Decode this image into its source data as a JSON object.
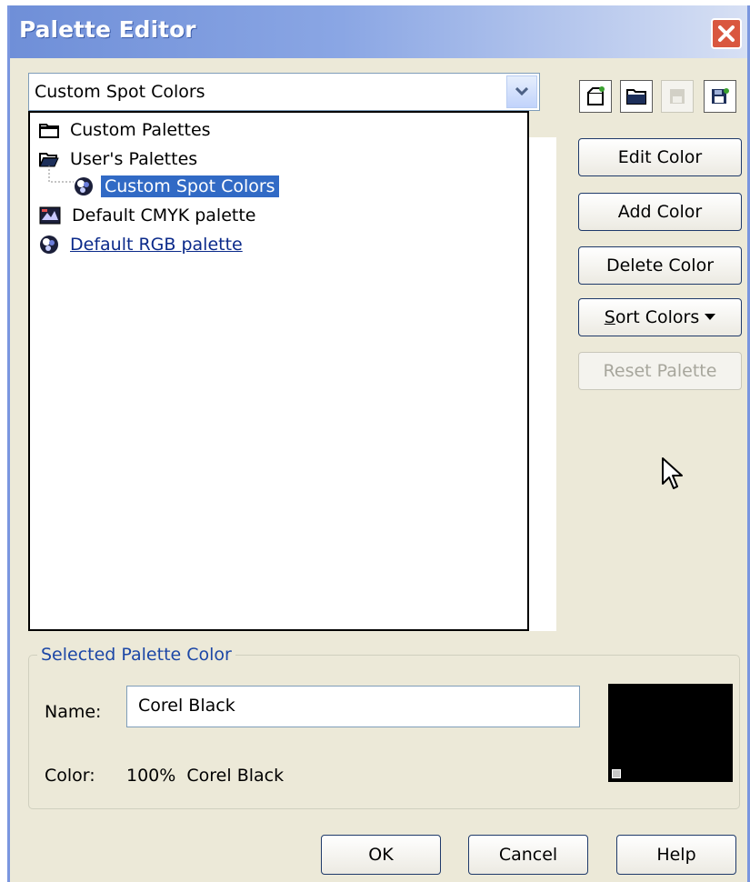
{
  "window": {
    "title": "Palette Editor"
  },
  "palette_select": {
    "value": "Custom Spot Colors"
  },
  "tree": {
    "items": [
      {
        "label": "Custom Palettes",
        "icon": "folder-closed-icon"
      },
      {
        "label": "User's Palettes",
        "icon": "folder-open-icon"
      },
      {
        "label": "Custom Spot Colors",
        "icon": "rgb-palette-icon",
        "selected": true
      },
      {
        "label": "Default CMYK palette",
        "icon": "cmyk-palette-icon"
      },
      {
        "label": "Default RGB palette",
        "icon": "rgb-palette-icon"
      }
    ]
  },
  "toolbar": {
    "new_palette": "new-palette-icon",
    "open_palette": "open-folder-icon",
    "save_palette": "save-disabled-icon",
    "save_as_palette": "save-as-icon"
  },
  "buttons": {
    "edit_color": "Edit Color",
    "add_color": "Add Color",
    "delete_color": "Delete Color",
    "sort_colors_prefix": "S",
    "sort_colors_rest": "ort Colors",
    "reset_palette": "Reset Palette"
  },
  "selected_color": {
    "legend": "Selected Palette Color",
    "name_label": "Name:",
    "name_value": "Corel Black",
    "color_label": "Color:",
    "color_value": "100%  Corel Black",
    "swatch_color": "#000000"
  },
  "dialog_buttons": {
    "ok": "OK",
    "cancel": "Cancel",
    "help": "Help"
  }
}
